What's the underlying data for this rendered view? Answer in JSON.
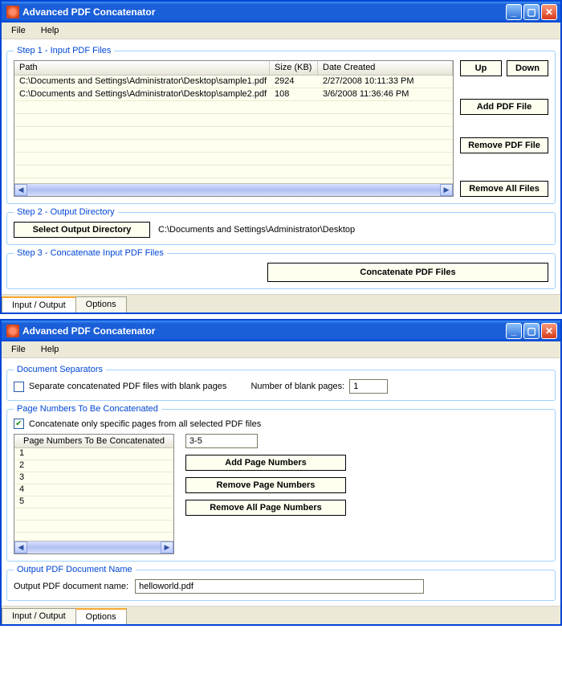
{
  "window1": {
    "title": "Advanced PDF Concatenator",
    "menus": {
      "file": "File",
      "help": "Help"
    },
    "step1": {
      "legend": "Step 1 - Input PDF Files",
      "columns": {
        "path": "Path",
        "size": "Size (KB)",
        "date": "Date Created"
      },
      "rows": [
        {
          "path": "C:\\Documents and Settings\\Administrator\\Desktop\\sample1.pdf",
          "size": "2924",
          "date": "2/27/2008 10:11:33 PM"
        },
        {
          "path": "C:\\Documents and Settings\\Administrator\\Desktop\\sample2.pdf",
          "size": "108",
          "date": "3/6/2008 11:36:46 PM"
        }
      ],
      "buttons": {
        "up": "Up",
        "down": "Down",
        "add": "Add PDF File",
        "remove": "Remove PDF File",
        "removeall": "Remove All Files"
      }
    },
    "step2": {
      "legend": "Step 2 - Output Directory",
      "button": "Select Output Directory",
      "path": "C:\\Documents and Settings\\Administrator\\Desktop"
    },
    "step3": {
      "legend": "Step 3 - Concatenate Input PDF Files",
      "button": "Concatenate PDF Files"
    },
    "tabs": {
      "io": "Input / Output",
      "options": "Options"
    }
  },
  "window2": {
    "title": "Advanced PDF Concatenator",
    "menus": {
      "file": "File",
      "help": "Help"
    },
    "sep": {
      "legend": "Document Separators",
      "checkbox": "Separate concatenated PDF files with blank pages",
      "numlabel": "Number of blank pages:",
      "numvalue": "1"
    },
    "pages": {
      "legend": "Page Numbers To Be Concatenated",
      "checkbox": "Concatenate only specific pages from all selected PDF files",
      "listheader": "Page Numbers To Be Concatenated",
      "rows": [
        "1",
        "2",
        "3",
        "4",
        "5"
      ],
      "inputvalue": "3-5",
      "buttons": {
        "add": "Add Page Numbers",
        "remove": "Remove Page Numbers",
        "removeall": "Remove All Page Numbers"
      }
    },
    "outname": {
      "legend": "Output PDF Document Name",
      "label": "Output PDF document name:",
      "value": "helloworld.pdf"
    },
    "tabs": {
      "io": "Input / Output",
      "options": "Options"
    }
  }
}
